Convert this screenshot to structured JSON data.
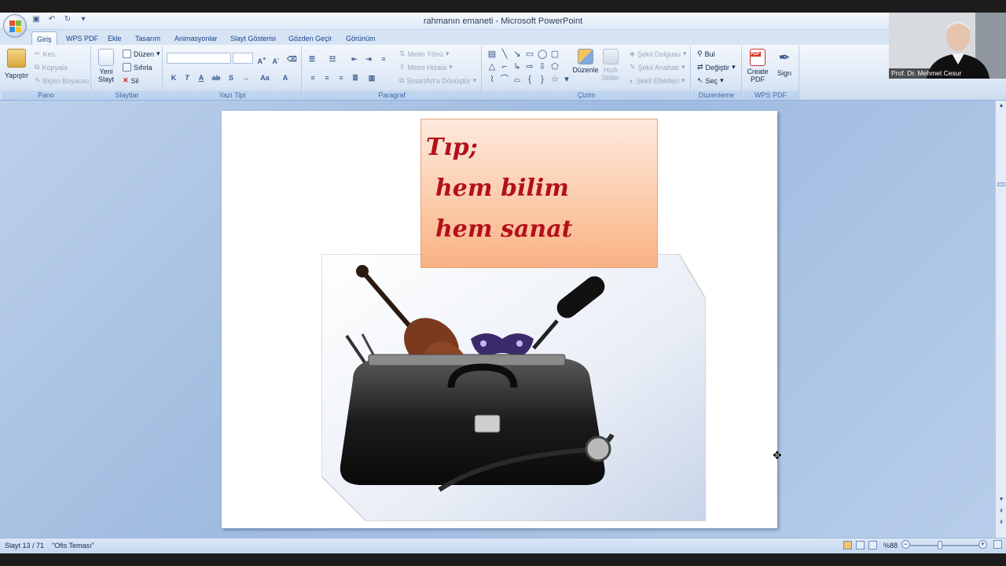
{
  "window": {
    "title": "rahmanın emaneti - Microsoft PowerPoint"
  },
  "tabs": [
    "Giriş",
    "WPS PDF",
    "Ekle",
    "Tasarım",
    "Animasyonlar",
    "Slayt Gösterisi",
    "Gözden Geçir",
    "Görünüm"
  ],
  "active_tab": "Giriş",
  "ribbon": {
    "pano": {
      "label": "Pano",
      "paste": "Yapıştır",
      "cut": "Kes",
      "copy": "Kopyala",
      "format_painter": "Biçim Boyacısı"
    },
    "slaytlar": {
      "label": "Slaytlar",
      "new_slide_1": "Yeni",
      "new_slide_2": "Slayt",
      "layout": "Düzen",
      "reset": "Sıfırla",
      "delete": "Sil"
    },
    "yazi_tipi": {
      "label": "Yazı Tipi",
      "bold": "K",
      "italic": "T",
      "underline": "A"
    },
    "paragraf": {
      "label": "Paragraf",
      "text_direction": "Metin Yönü",
      "align_text": "Metni Hizala",
      "smartart": "SmartArt'a Dönüştür"
    },
    "cizim": {
      "label": "Çizim",
      "arrange": "Düzenle",
      "quick_styles_1": "Hızlı",
      "quick_styles_2": "Stiller",
      "shape_fill": "Şekil Dolgusu",
      "shape_outline": "Şekil Anahatı",
      "shape_effects": "Şekil Efektleri"
    },
    "duzenleme": {
      "label": "Düzenleme",
      "find": "Bul",
      "replace": "Değiştir",
      "select": "Seç"
    },
    "wps_pdf": {
      "label": "WPS PDF",
      "create_pdf_1": "Create",
      "create_pdf_2": "PDF",
      "sign": "Sign",
      "pdf_badge": "PDF"
    }
  },
  "slide": {
    "note_lines": [
      "Tıp;",
      "hem bilim",
      "hem sanat"
    ]
  },
  "status": {
    "slide_counter": "Slayt 13 / 71",
    "theme": "\"Ofis Teması\"",
    "zoom": "%88"
  },
  "webcam": {
    "name": "Prof. Dr. Mehmet Cesur"
  },
  "colors": {
    "accent": "#15428b",
    "note_text": "#b4101a"
  }
}
